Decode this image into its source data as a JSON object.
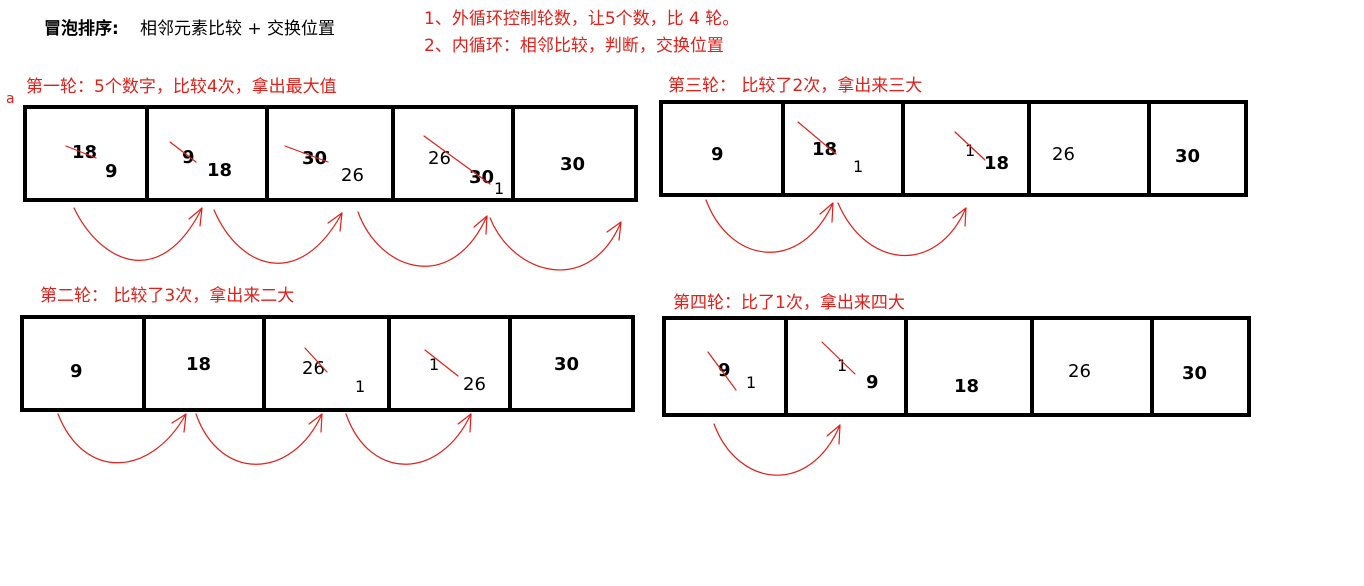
{
  "header": {
    "title_bold": "冒泡排序:",
    "title_rest": "相邻元素比较   +   交换位置",
    "note1": "1、外循环控制轮数，让5个数，比 4 轮。",
    "note2": "2、内循环：相邻比较，判断，交换位置"
  },
  "rounds": {
    "r1": {
      "label": "第一轮：5个数字，比较4次，拿出最大值",
      "corner_mark": "a",
      "cells": [
        {
          "old": "18",
          "new": "9"
        },
        {
          "old": "9",
          "new": "18"
        },
        {
          "old": "30",
          "new": "26"
        },
        {
          "old": "26",
          "new": "30",
          "extra": "1"
        },
        {
          "value": "30"
        }
      ]
    },
    "r2": {
      "label": "第二轮：  比较了3次，拿出来二大",
      "cells": [
        {
          "value": "9"
        },
        {
          "value": "18"
        },
        {
          "old": "26",
          "new": "1"
        },
        {
          "old": "1",
          "new": "26"
        },
        {
          "value": "30"
        }
      ]
    },
    "r3": {
      "label": "第三轮：  比较了2次，拿出来三大",
      "cells": [
        {
          "value": "9"
        },
        {
          "old": "18",
          "new": "1"
        },
        {
          "old": "1",
          "new": "18"
        },
        {
          "value": "26"
        },
        {
          "value": "30"
        }
      ]
    },
    "r4": {
      "label": "第四轮：比了1次，拿出来四大",
      "cells": [
        {
          "old": "9",
          "new": "1"
        },
        {
          "old": "1",
          "new": "9"
        },
        {
          "value": "18"
        },
        {
          "value": "26"
        },
        {
          "value": "30"
        }
      ]
    }
  },
  "colors": {
    "annotation": "#e0201a",
    "box": "#000000"
  }
}
